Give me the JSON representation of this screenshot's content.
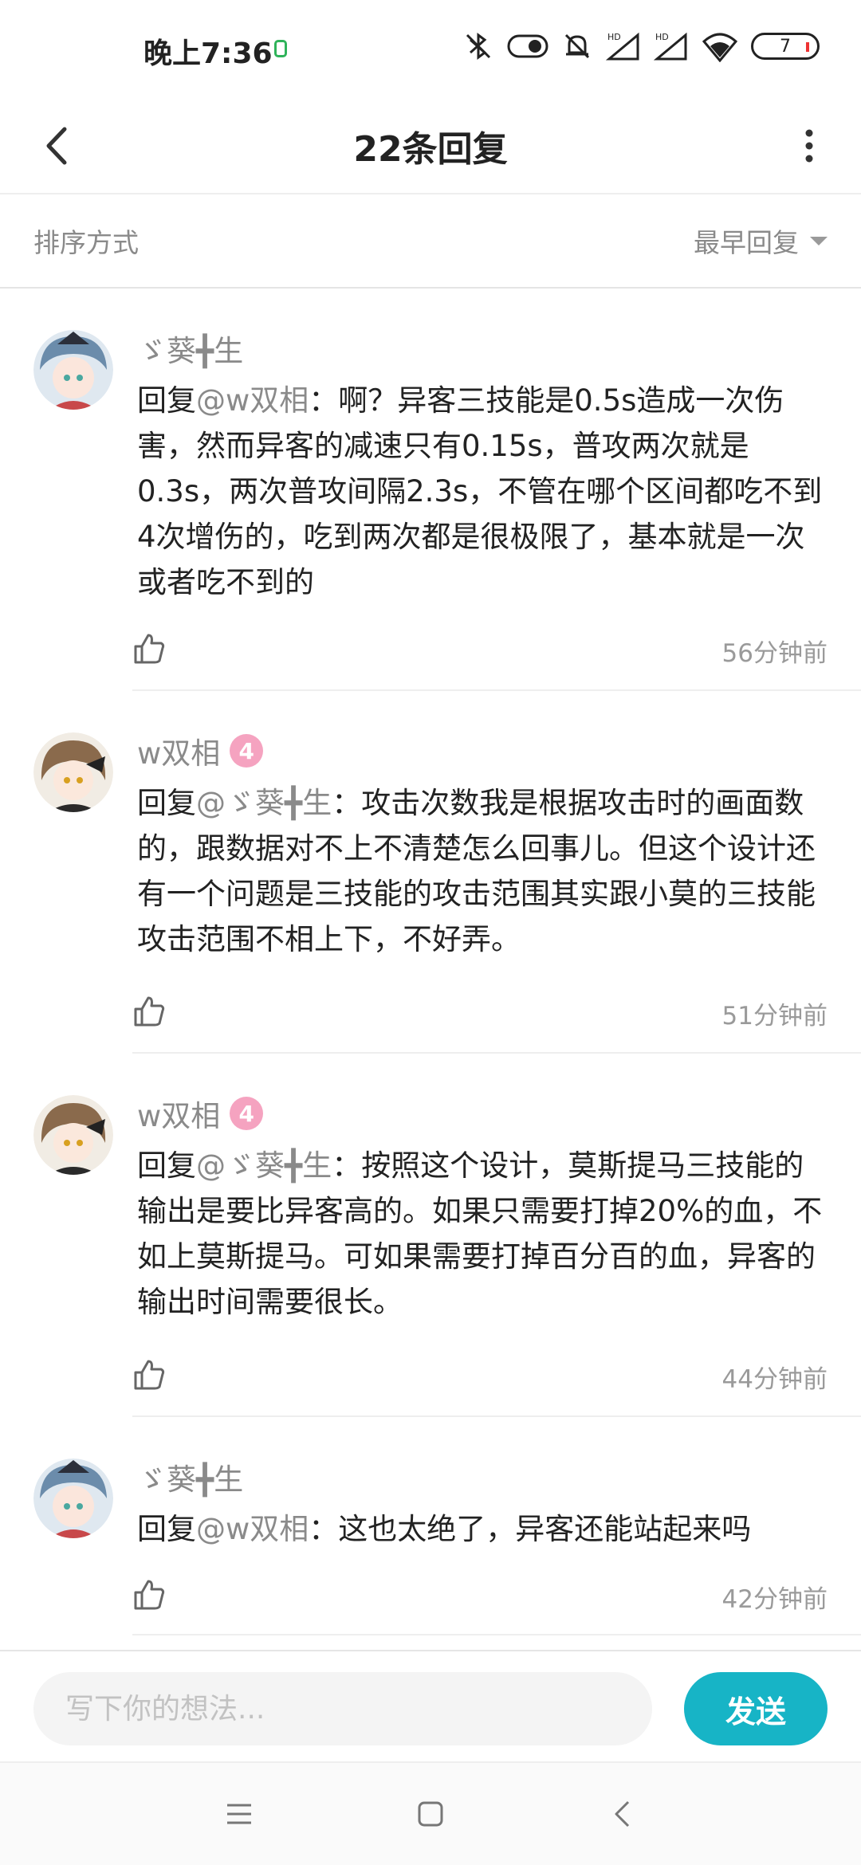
{
  "status": {
    "time": "晚上7:36",
    "battery": "7"
  },
  "header": {
    "title": "22条回复"
  },
  "sort": {
    "label": "排序方式",
    "selected": "最早回复"
  },
  "comments": [
    {
      "name": "ゞ葵╋生",
      "level": "",
      "mention": "@w双相",
      "text": "：啊？异客三技能是0.5s造成一次伤害，然而异客的减速只有0.15s，普攻两次就是0.3s，两次普攻间隔2.3s，不管在哪个区间都吃不到4次增伤的，吃到两次都是很极限了，基本就是一次或者吃不到的",
      "time": "56分钟前"
    },
    {
      "name": "w双相",
      "level": "4",
      "mention": "@ゞ葵╋生",
      "text": "：攻击次数我是根据攻击时的画面数的，跟数据对不上不清楚怎么回事儿。但这个设计还有一个问题是三技能的攻击范围其实跟小莫的三技能攻击范围不相上下，不好弄。",
      "time": "51分钟前"
    },
    {
      "name": "w双相",
      "level": "4",
      "mention": "@ゞ葵╋生",
      "text": "：按照这个设计，莫斯提马三技能的输出是要比异客高的。如果只需要打掉20%的血，不如上莫斯提马。可如果需要打掉百分百的血，异客的输出时间需要很长。",
      "time": "44分钟前"
    },
    {
      "name": "ゞ葵╋生",
      "level": "",
      "mention": "@w双相",
      "text": "：这也太绝了，异客还能站起来吗",
      "time": "42分钟前"
    }
  ],
  "reply_prefix": "回复",
  "composer": {
    "placeholder": "写下你的想法...",
    "send_label": "发送"
  }
}
